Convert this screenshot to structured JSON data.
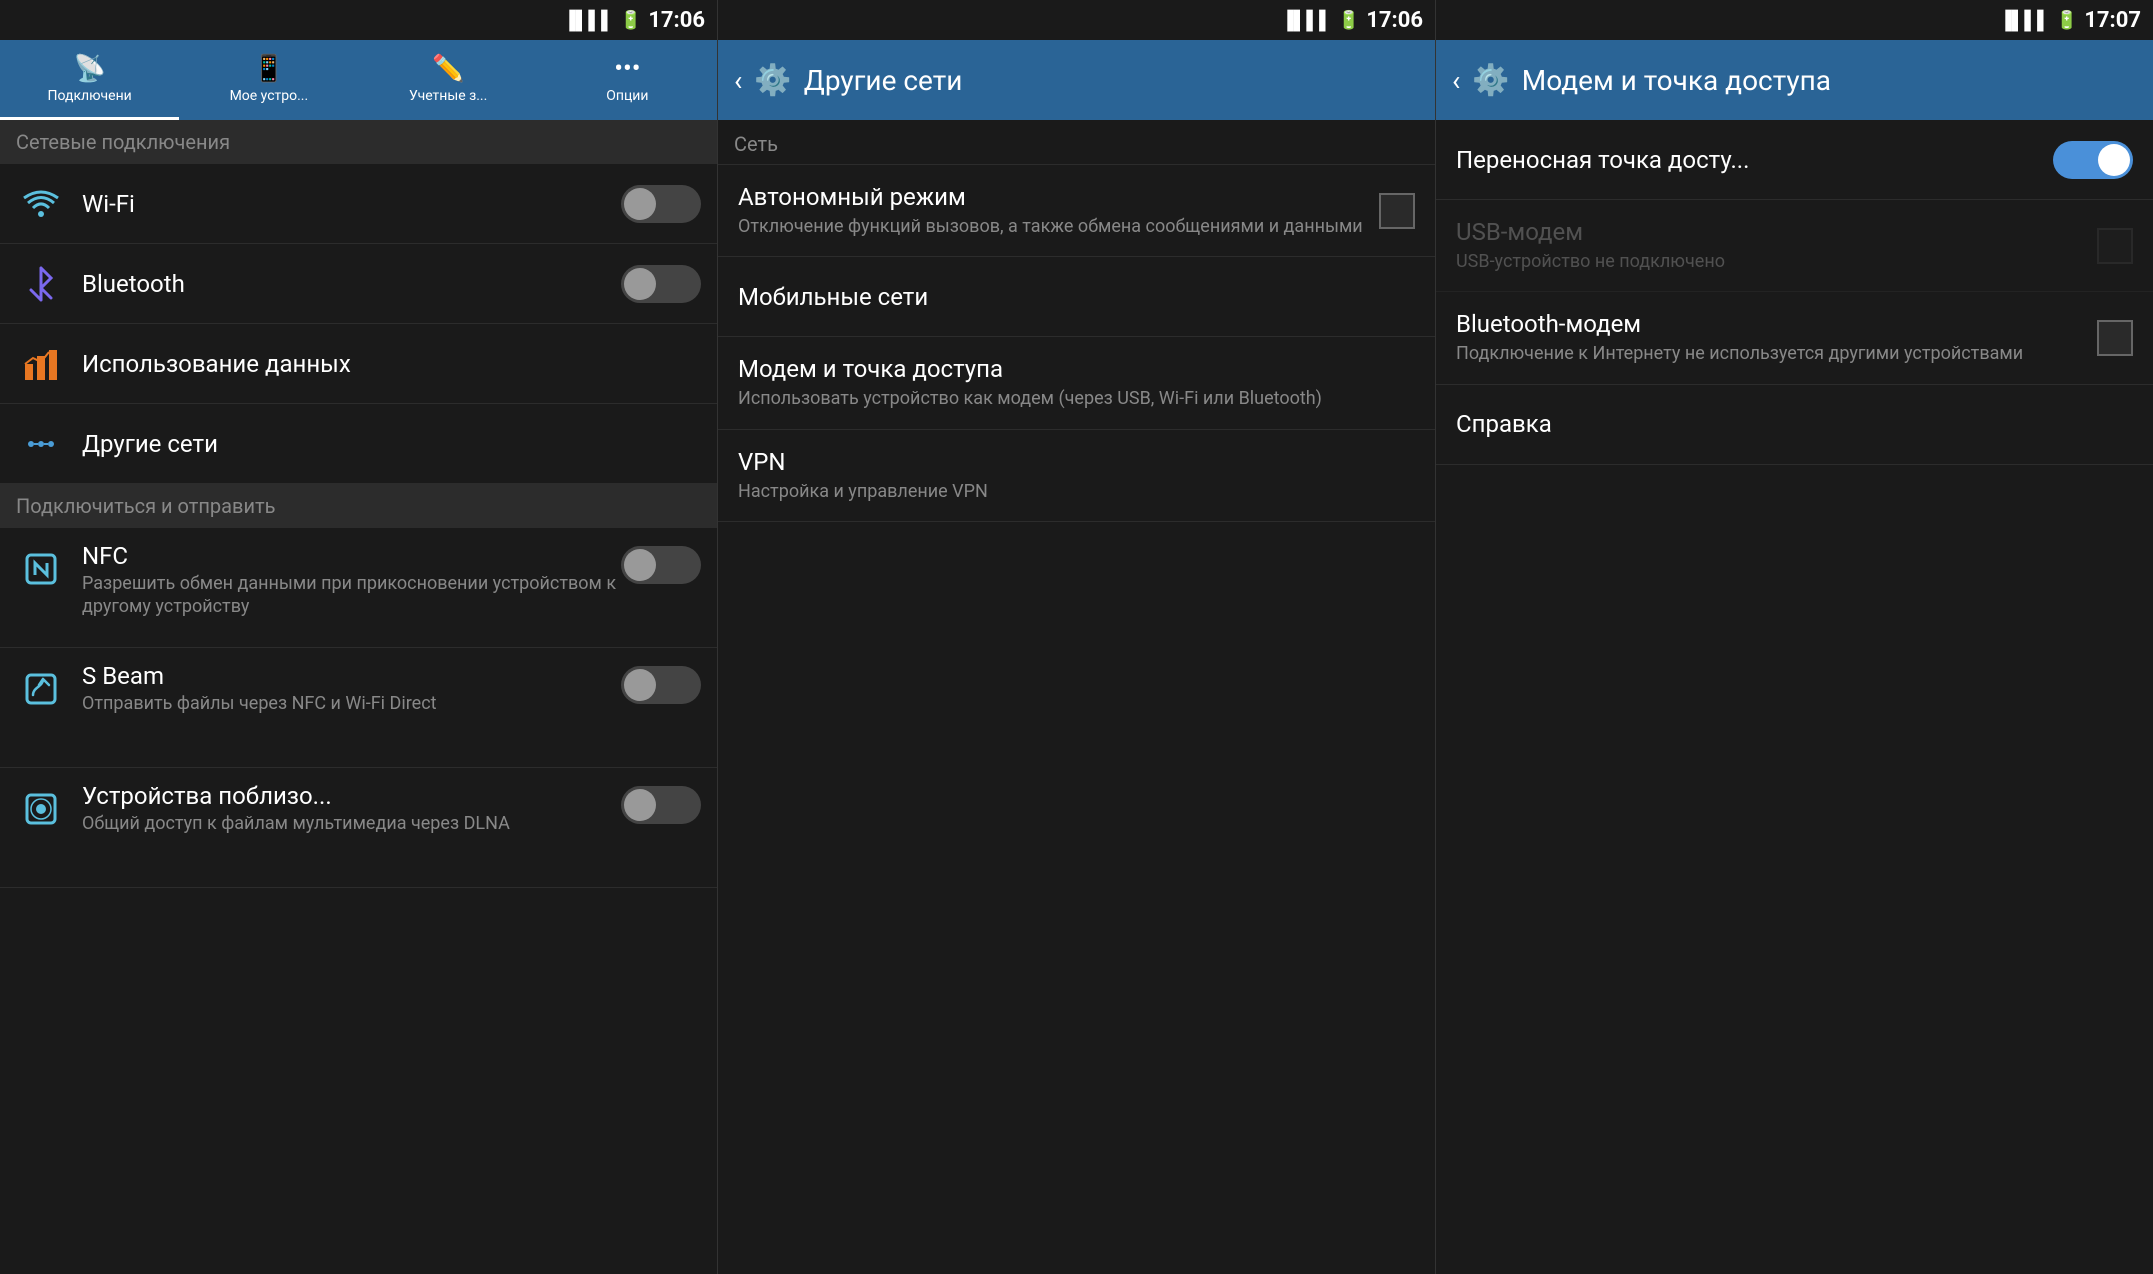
{
  "panel1": {
    "status": {
      "time": "17:06",
      "battery": "98%"
    },
    "tabs": [
      {
        "id": "connections",
        "label": "Подключени",
        "icon": "📡",
        "active": true
      },
      {
        "id": "mydevice",
        "label": "Мое устро...",
        "icon": "📱",
        "active": false
      },
      {
        "id": "accounts",
        "label": "Учетные з...",
        "icon": "✏️",
        "active": false
      },
      {
        "id": "options",
        "label": "Опции",
        "icon": "···",
        "active": false
      }
    ],
    "network_section": {
      "label": "Сетевые подключения",
      "items": [
        {
          "id": "wifi",
          "title": "Wi-Fi",
          "toggle": "off",
          "icon": "wifi"
        },
        {
          "id": "bluetooth",
          "title": "Bluetooth",
          "toggle": "off",
          "icon": "bluetooth"
        },
        {
          "id": "datausage",
          "title": "Использование данных",
          "toggle": null,
          "icon": "data"
        },
        {
          "id": "othernets",
          "title": "Другие сети",
          "toggle": null,
          "icon": "netsettings"
        }
      ]
    },
    "connect_section": {
      "label": "Подключиться и отправить",
      "items": [
        {
          "id": "nfc",
          "title": "NFC",
          "subtitle": "Разрешить обмен данными при прикосновении устройством к другому устройству",
          "toggle": "off",
          "icon": "nfc"
        },
        {
          "id": "sbeam",
          "title": "S Beam",
          "subtitle": "Отправить файлы через NFC и Wi-Fi Direct",
          "toggle": "off",
          "icon": "sbeam"
        },
        {
          "id": "nearby",
          "title": "Устройства поблизо...",
          "subtitle": "Общий доступ к файлам мультимедиа через DLNA",
          "toggle": "off",
          "icon": "nearby"
        }
      ]
    }
  },
  "panel2": {
    "status": {
      "time": "17:06",
      "battery": "98%"
    },
    "header": {
      "title": "Другие сети",
      "back_label": "‹"
    },
    "sections": [
      {
        "label": "Сеть",
        "items": [
          {
            "id": "airplane",
            "title": "Автономный режим",
            "subtitle": "Отключение функций вызовов, а также обмена сообщениями и данными",
            "has_checkbox": true
          },
          {
            "id": "mobile",
            "title": "Мобильные сети",
            "subtitle": null,
            "has_checkbox": false
          },
          {
            "id": "tethering",
            "title": "Модем и точка доступа",
            "subtitle": "Использовать устройство как модем (через USB, Wi-Fi или Bluetooth)",
            "has_checkbox": false
          },
          {
            "id": "vpn",
            "title": "VPN",
            "subtitle": "Настройка и управление VPN",
            "has_checkbox": false
          }
        ]
      }
    ]
  },
  "panel3": {
    "status": {
      "time": "17:07",
      "battery": "98%"
    },
    "header": {
      "title": "Модем и точка доступа",
      "back_label": "‹"
    },
    "items": [
      {
        "id": "hotspot",
        "title": "Переносная точка досту...",
        "subtitle": null,
        "toggle": "on"
      },
      {
        "id": "usbmodem",
        "title": "USB-модем",
        "subtitle": "USB-устройство не подключено",
        "has_checkbox": true,
        "disabled": true
      },
      {
        "id": "btmodem",
        "title": "Bluetooth-модем",
        "subtitle": "Подключение к Интернету не используется другими устройствами",
        "has_checkbox": true,
        "disabled": false
      },
      {
        "id": "help",
        "title": "Справка",
        "subtitle": null,
        "has_checkbox": false,
        "disabled": false
      }
    ]
  }
}
